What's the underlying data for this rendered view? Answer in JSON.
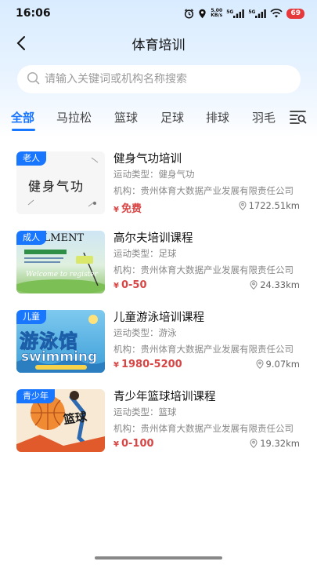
{
  "status_bar": {
    "time": "16:06",
    "net_speed_value": "5.00",
    "net_speed_unit": "KB/s",
    "signal1": "5G",
    "signal2": "5G",
    "battery": "69",
    "icons": [
      "alarm-icon",
      "location-icon",
      "signal-icon",
      "wifi-icon",
      "battery-icon"
    ]
  },
  "header": {
    "title": "体育培训"
  },
  "search": {
    "placeholder": "请输入关键词或机构名称搜索"
  },
  "tabs": [
    {
      "label": "全部",
      "active": true
    },
    {
      "label": "马拉松"
    },
    {
      "label": "篮球"
    },
    {
      "label": "足球"
    },
    {
      "label": "排球"
    },
    {
      "label": "羽毛"
    }
  ],
  "list": [
    {
      "tag": "老人",
      "thumb_text": "健身气功",
      "title": "健身气功培训",
      "type_label": "运动类型：健身气功",
      "org_label": "机构：贵州体育大数据产业发展有限责任公司",
      "price_symbol": "¥",
      "price": "免费",
      "distance": "1722.51km"
    },
    {
      "tag": "成人",
      "thumb_text": "LLMENT",
      "title": "高尔夫培训课程",
      "type_label": "运动类型：足球",
      "org_label": "机构：贵州体育大数据产业发展有限责任公司",
      "price_symbol": "¥",
      "price": "0-50",
      "distance": "24.33km"
    },
    {
      "tag": "儿童",
      "thumb_text": "游泳馆",
      "thumb_subtext": "swimming",
      "title": "儿童游泳培训课程",
      "type_label": "运动类型：游泳",
      "org_label": "机构：贵州体育大数据产业发展有限责任公司",
      "price_symbol": "¥",
      "price": "1980-5200",
      "distance": "9.07km"
    },
    {
      "tag": "青少年",
      "thumb_text": "篮球",
      "title": "青少年篮球培训课程",
      "type_label": "运动类型：篮球",
      "org_label": "机构：贵州体育大数据产业发展有限责任公司",
      "price_symbol": "¥",
      "price": "0-100",
      "distance": "19.32km"
    }
  ],
  "colors": {
    "accent": "#1976ff",
    "price": "#d84545",
    "battery": "#e5393b"
  }
}
